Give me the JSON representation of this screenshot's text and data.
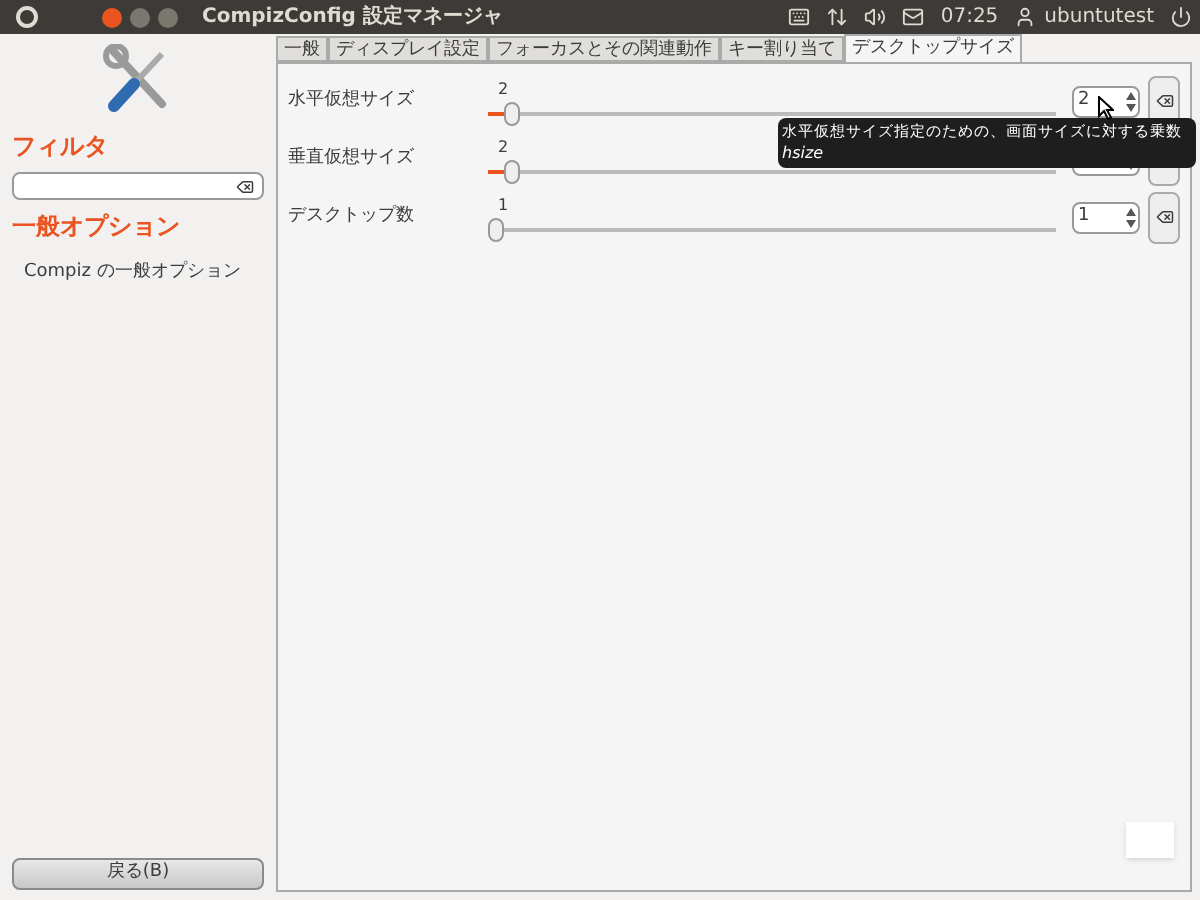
{
  "window": {
    "title": "CompizConfig 設定マネージャ"
  },
  "panel": {
    "time": "07:25",
    "user": "ubuntutest"
  },
  "sidebar": {
    "filter_label": "フィルタ",
    "section": "一般オプション",
    "items": [
      {
        "label": "Compiz の一般オプション"
      }
    ],
    "back_button": "戻る(B)"
  },
  "tabs": [
    {
      "label": "一般",
      "selected": false
    },
    {
      "label": "ディスプレイ設定",
      "selected": false
    },
    {
      "label": "フォーカスとその関連動作",
      "selected": false
    },
    {
      "label": "キー割り当て",
      "selected": false
    },
    {
      "label": "デスクトップサイズ",
      "selected": true
    }
  ],
  "settings": [
    {
      "label": "水平仮想サイズ",
      "reading": "2",
      "level": 0.03,
      "value": "2"
    },
    {
      "label": "垂直仮想サイズ",
      "reading": "2",
      "level": 0.03
    },
    {
      "label": "デスクトップ数",
      "reading": "1",
      "level": 0,
      "value": "1"
    }
  ],
  "tooltip": {
    "text": "水平仮想サイズ指定のための、画面サイズに対する乗数",
    "key": "hsize"
  }
}
